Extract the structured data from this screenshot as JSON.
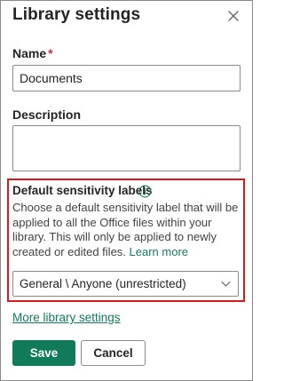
{
  "header": {
    "title": "Library settings",
    "close_icon": "close-icon"
  },
  "name_field": {
    "label": "Name",
    "required_marker": "*",
    "value": "Documents"
  },
  "description_field": {
    "label": "Description",
    "value": ""
  },
  "sensitivity": {
    "title": "Default sensitivity labels",
    "info_icon": "info-icon",
    "description": "Choose a default sensitivity label that will be applied to all the Office files within your library. This will only be applied to newly created or edited files.",
    "learn_more": "Learn more",
    "selected_label": "General \\ Anyone (unrestricted)",
    "highlight_color": "#d9191b"
  },
  "links": {
    "more_settings": "More library settings"
  },
  "buttons": {
    "save": "Save",
    "cancel": "Cancel"
  },
  "colors": {
    "accent": "#0f7b5a"
  }
}
